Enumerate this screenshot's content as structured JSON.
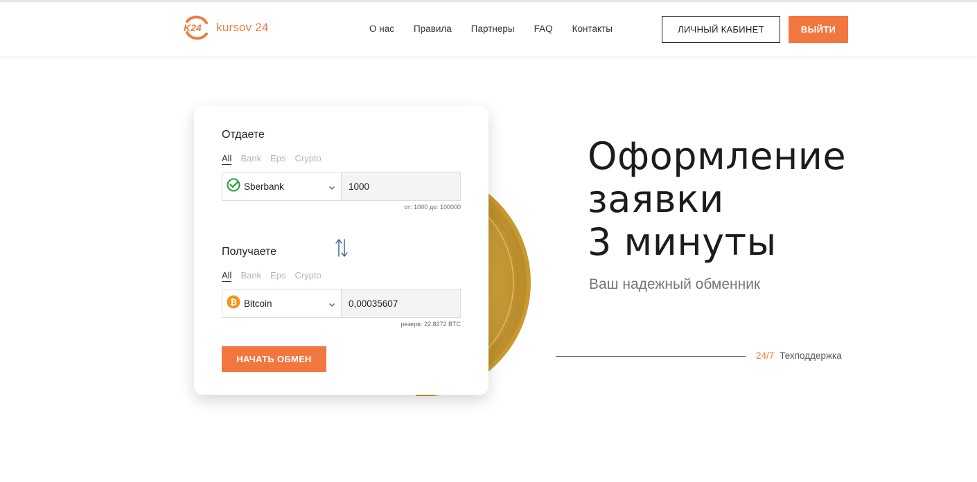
{
  "brand": {
    "logo_mark": "K24",
    "name": "kursov 24",
    "accent_color": "#f2773f"
  },
  "nav": {
    "items": [
      {
        "label": "О нас"
      },
      {
        "label": "Правила"
      },
      {
        "label": "Партнеры"
      },
      {
        "label": "FAQ"
      },
      {
        "label": "Контакты"
      }
    ]
  },
  "header": {
    "cabinet_label": "ЛИЧНЫЙ КАБИНЕТ",
    "logout_label": "ВЫЙТИ"
  },
  "exchange": {
    "give": {
      "title": "Отдаете",
      "tabs": [
        "All",
        "Bank",
        "Eps",
        "Crypto"
      ],
      "active_tab": "All",
      "currency": "Sberbank",
      "currency_icon": "sberbank-icon",
      "amount": "1000",
      "hint": "от: 1000 до: 100000"
    },
    "receive": {
      "title": "Получаете",
      "tabs": [
        "All",
        "Bank",
        "Eps",
        "Crypto"
      ],
      "active_tab": "All",
      "currency": "Bitcoin",
      "currency_icon": "bitcoin-icon",
      "amount": "0,00035607",
      "hint": "резерв: 22,8272 BTC"
    },
    "start_label": "НАЧАТЬ ОБМЕН"
  },
  "hero": {
    "title_lines": [
      "Оформление",
      "заявки",
      "3 минуты"
    ],
    "subtitle": "Ваш надежный обменник",
    "support_accent": "24/7",
    "support_label": "Техподдержка"
  }
}
